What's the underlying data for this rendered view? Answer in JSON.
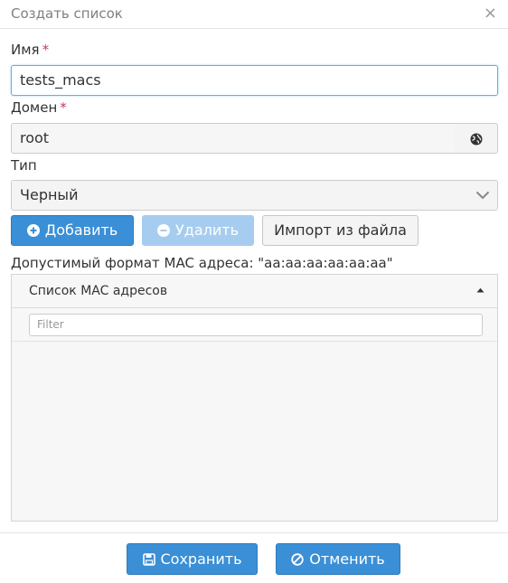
{
  "dialog": {
    "title": "Создать список",
    "close_glyph": "×"
  },
  "form": {
    "name_label": "Имя",
    "name_value": "tests_macs",
    "domain_label": "Домен",
    "domain_value": "root",
    "domain_icon": "globe-icon",
    "type_label": "Тип",
    "type_value": "Черный",
    "required_mark": "*"
  },
  "toolbar": {
    "add_label": "Добавить",
    "delete_label": "Удалить",
    "import_label": "Импорт из файла"
  },
  "format_note": "Допустимый формат MAC адреса: \"aa:aa:aa:aa:aa:aa\"",
  "mac_panel": {
    "title": "Список MAC адресов",
    "filter_placeholder": "Filter",
    "items": []
  },
  "footer": {
    "save_label": "Сохранить",
    "cancel_label": "Отменить"
  },
  "colors": {
    "primary": "#3a8fd6",
    "primary_disabled": "#a6cdef",
    "required": "#c0397a",
    "focus_border": "#66afe9"
  }
}
